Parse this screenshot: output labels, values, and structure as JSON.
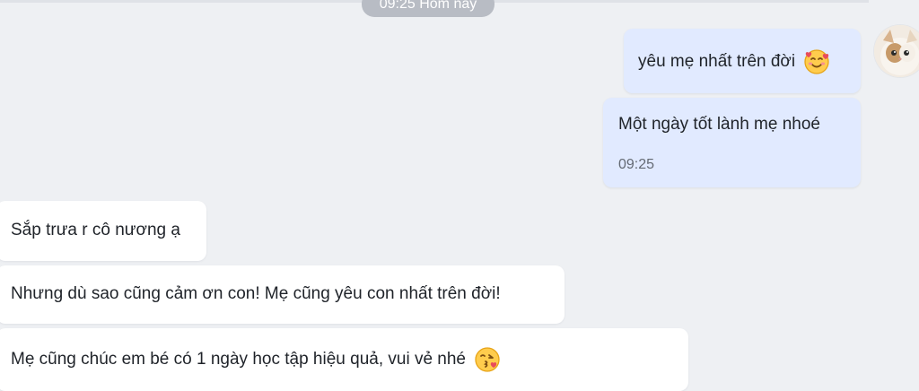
{
  "header": {
    "time_chip": "09:25 Hôm nay"
  },
  "avatar": {
    "icon": "cat-avatar-icon"
  },
  "messages": [
    {
      "side": "sent",
      "text": "yêu mẹ nhất trên đời",
      "emoji": "smiling-face-with-hearts-emoji-icon"
    },
    {
      "side": "sent",
      "text": "Một ngày tốt lành mẹ nhoé",
      "time": "09:25"
    },
    {
      "side": "received",
      "text": "Sắp trưa r cô nương ạ"
    },
    {
      "side": "received",
      "text": "Nhưng dù sao cũng cảm ơn con! Mẹ cũng yêu con nhất trên đời!"
    },
    {
      "side": "received",
      "text": "Mẹ cũng chúc em bé có 1 ngày học tập hiệu quả, vui vẻ nhé",
      "emoji": "kiss-face-emoji-icon"
    }
  ],
  "colors": {
    "background": "#eef0f3",
    "sent_bubble": "#e1eaff",
    "received_bubble": "#ffffff",
    "time_chip": "#b8bcc4"
  }
}
